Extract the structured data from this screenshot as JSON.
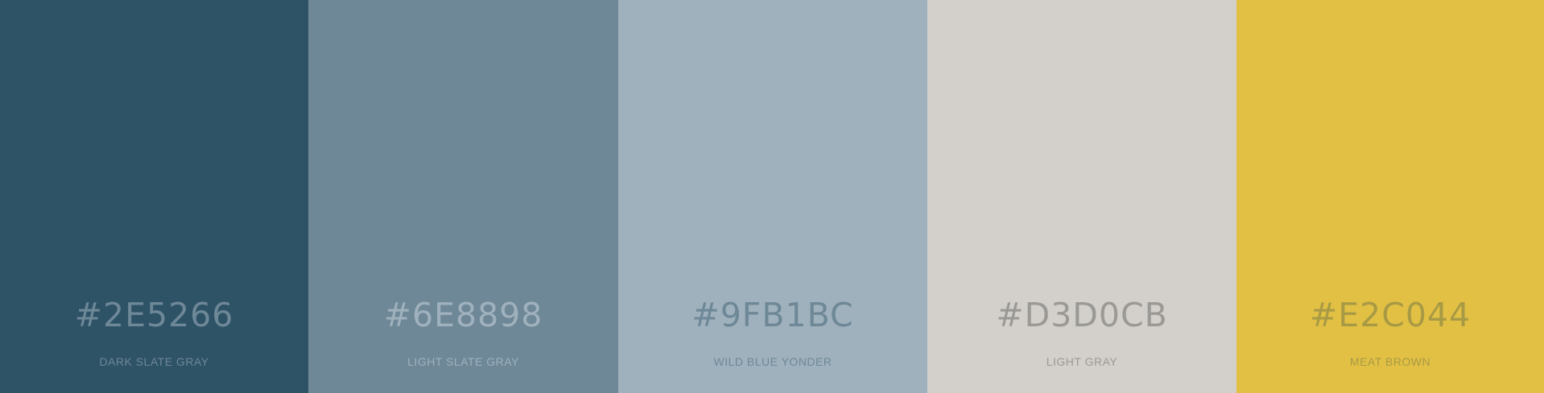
{
  "swatches": [
    {
      "hex": "#2E5266",
      "name": "DARK SLATE GRAY",
      "color": "#2E5266",
      "text_color": "#6E8898"
    },
    {
      "hex": "#6E8898",
      "name": "LIGHT SLATE GRAY",
      "color": "#6E8898",
      "text_color": "#9FB1BC"
    },
    {
      "hex": "#9FB1BC",
      "name": "WILD BLUE YONDER",
      "color": "#9FB1BC",
      "text_color": "#6E8898"
    },
    {
      "hex": "#D3D0CB",
      "name": "LIGHT GRAY",
      "color": "#D3D0CB",
      "text_color": "#9A9996"
    },
    {
      "hex": "#E2C044",
      "name": "MEAT BROWN",
      "color": "#E2C044",
      "text_color": "#A89A44"
    }
  ]
}
